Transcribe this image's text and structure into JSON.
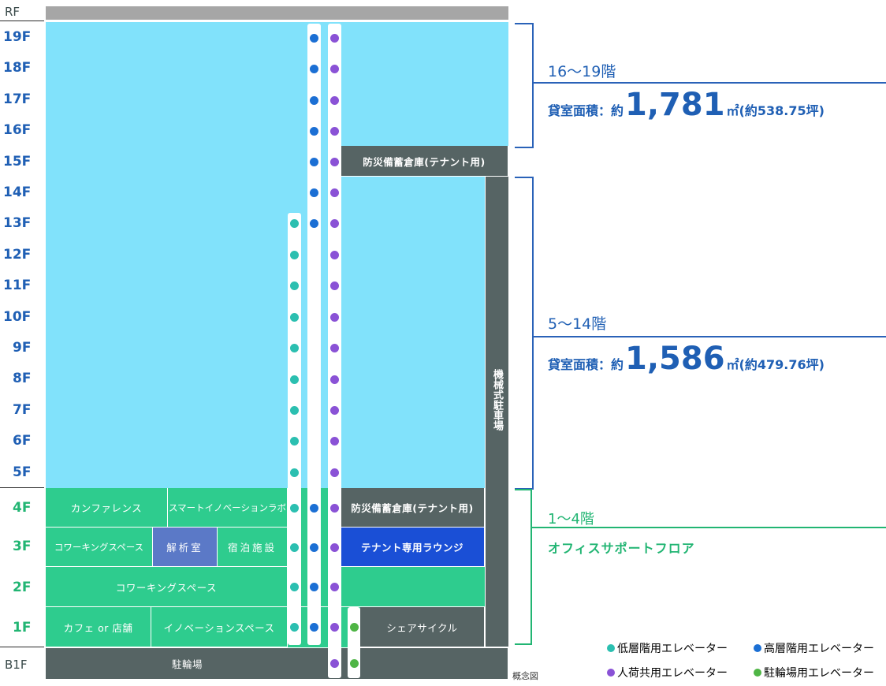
{
  "floors": {
    "rf": "RF",
    "f19": "19F",
    "f18": "18F",
    "f17": "17F",
    "f16": "16F",
    "f15": "15F",
    "f14": "14F",
    "f13": "13F",
    "f12": "12F",
    "f11": "11F",
    "f10": "10F",
    "f9": "9F",
    "f8": "8F",
    "f7": "7F",
    "f6": "6F",
    "f5": "5F",
    "f4": "4F",
    "f3": "3F",
    "f2": "2F",
    "f1": "1F",
    "b1f": "B1F"
  },
  "zones": {
    "storage15": "防災備蓄倉庫(テナント用)",
    "parking_mech": "機械式駐車場",
    "conference": "カンファレンス",
    "smart_lab": "スマートイノベーションラボ",
    "storage4": "防災備蓄倉庫(テナント用)",
    "coworking3": "コワーキングスペース",
    "analysis": "解析室",
    "lodging": "宿泊施設",
    "lounge": "テナント専用ラウンジ",
    "coworking2": "コワーキングスペース",
    "cafe": "カフェ or 店舗",
    "innovation": "イノベーションスペース",
    "cycle": "シェアサイクル",
    "parking_b1": "駐輪場"
  },
  "right": {
    "upper_title": "16～19階",
    "upper_area_prefix": "貸室面積：約",
    "upper_area_value": "1,781",
    "upper_area_suffix": "㎡(約538.75坪)",
    "mid_title": "5～14階",
    "mid_area_prefix": "貸室面積：約",
    "mid_area_value": "1,586",
    "mid_area_suffix": "㎡(約479.76坪)",
    "low_title": "1～4階",
    "low_subtitle": "オフィスサポートフロア"
  },
  "legend": {
    "low": "低層階用エレベーター",
    "high": "高層階用エレベーター",
    "cargo": "人荷共用エレベーター",
    "bike": "駐輪場用エレベーター"
  },
  "note": "概念図",
  "colors": {
    "office": "#81e2fb",
    "support": "#2ecc8e",
    "dark": "#566464",
    "accent_blue": "#1a4fd6",
    "analysis": "#5b79c7",
    "teal_elev": "#2bbfb0",
    "blue_elev": "#1b6fd4",
    "purple_elev": "#8a52d6",
    "green_elev": "#4fb545"
  }
}
